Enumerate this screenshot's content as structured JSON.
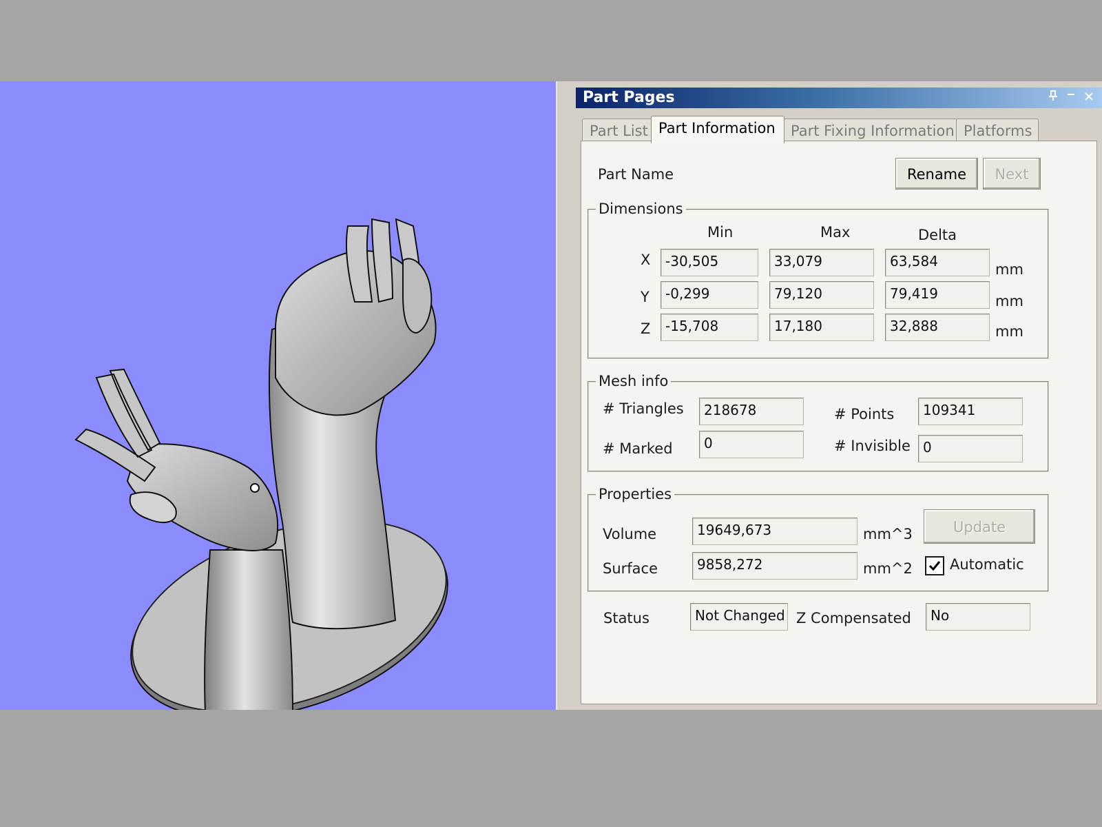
{
  "panel": {
    "title": "Part Pages",
    "pin_icon": "pin-icon",
    "minimize_icon": "minimize-icon",
    "close_icon": "close-icon"
  },
  "tabs": [
    "Part List",
    "Part Information",
    "Part Fixing Information",
    "Platforms"
  ],
  "active_tab": "Part Information",
  "part_name": {
    "label": "Part Name",
    "rename_button": "Rename",
    "next_button": "Next"
  },
  "dimensions": {
    "title": "Dimensions",
    "col_headers": [
      "Min",
      "Max",
      "Delta"
    ],
    "unit": "mm",
    "rows": [
      {
        "axis": "X",
        "min": "-30,505",
        "max": "33,079",
        "delta": "63,584"
      },
      {
        "axis": "Y",
        "min": "-0,299",
        "max": "79,120",
        "delta": "79,419"
      },
      {
        "axis": "Z",
        "min": "-15,708",
        "max": "17,180",
        "delta": "32,888"
      }
    ]
  },
  "mesh": {
    "title": "Mesh info",
    "triangles_label": "# Triangles",
    "triangles": "218678",
    "points_label": "# Points",
    "points": "109341",
    "marked_label": "# Marked",
    "marked": "0",
    "invisible_label": "# Invisible",
    "invisible": "0"
  },
  "properties": {
    "title": "Properties",
    "volume_label": "Volume",
    "volume": "19649,673",
    "volume_unit": "mm^3",
    "surface_label": "Surface",
    "surface": "9858,272",
    "surface_unit": "mm^2",
    "update_button": "Update",
    "automatic_label": "Automatic",
    "automatic_checked": true
  },
  "status": {
    "label": "Status",
    "value": "Not Changed",
    "zcomp_label": "Z Compensated",
    "zcomp_value": "No"
  },
  "colors": {
    "viewport_bg": "#8c8cff",
    "model": "#b8b8b8",
    "title_gradient_start": "#0b246a"
  }
}
